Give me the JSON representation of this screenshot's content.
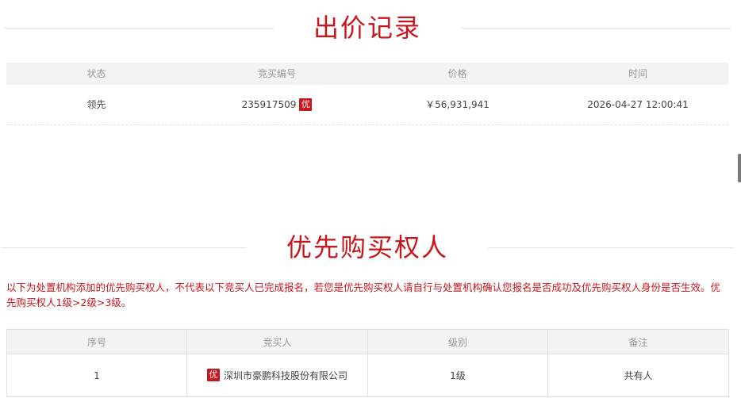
{
  "bid_section": {
    "title": "出价记录",
    "headers": {
      "status": "状态",
      "bid_no": "竞买编号",
      "price": "价格",
      "time": "时间"
    },
    "rows": [
      {
        "status": "领先",
        "bid_no": "235917509",
        "badge": "优",
        "price": "￥56,931,941",
        "time": "2026-04-27 12:00:41"
      }
    ]
  },
  "pref_section": {
    "title": "优先购买权人",
    "notice": "以下为处置机构添加的优先购买权人，不代表以下竞买人已完成报名，若您是优先购买权人请自行与处置机构确认您报名是否成功及优先购买权人身份是否生效。优先购买权人1级>2级>3级。",
    "headers": {
      "seq": "序号",
      "bidder": "竞买人",
      "level": "级别",
      "remark": "备注"
    },
    "rows": [
      {
        "seq": "1",
        "badge": "优",
        "bidder": "深圳市豪鹏科技股份有限公司",
        "level": "1级",
        "remark": "共有人"
      }
    ]
  },
  "colors": {
    "accent": "#c8161d",
    "header_bg": "#f3f3f3",
    "border": "#e0e0e0"
  }
}
